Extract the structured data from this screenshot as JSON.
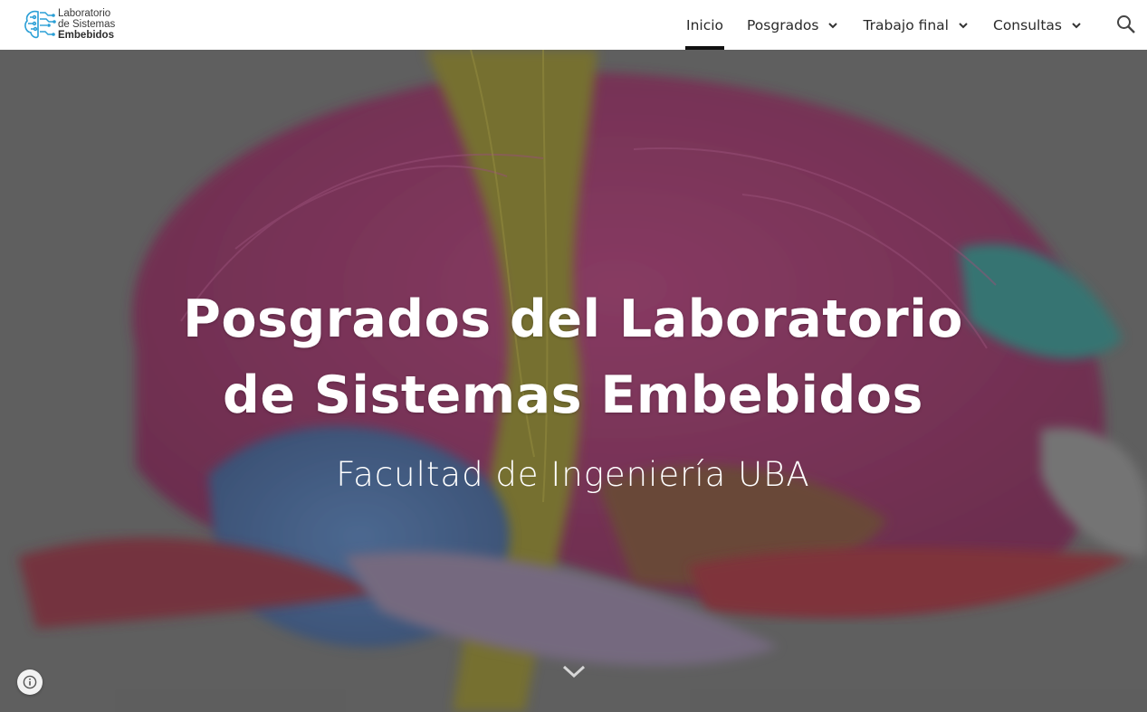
{
  "site": {
    "logo_line1": "Laboratorio",
    "logo_line2": "de Sistemas",
    "logo_line3": "Embebidos"
  },
  "nav": {
    "items": [
      {
        "label": "Inicio",
        "active": true,
        "has_dropdown": false
      },
      {
        "label": "Posgrados",
        "active": false,
        "has_dropdown": true
      },
      {
        "label": "Trabajo final",
        "active": false,
        "has_dropdown": true
      },
      {
        "label": "Consultas",
        "active": false,
        "has_dropdown": true
      }
    ],
    "search_icon": "search-icon"
  },
  "hero": {
    "title_line1": "Posgrados del Laboratorio",
    "title_line2": "de Sistemas Embebidos",
    "subtitle": "Facultad de Ingeniería UBA",
    "background": "brain tractography fibers"
  },
  "footer": {
    "info_icon": "info-icon"
  },
  "colors": {
    "header_bg": "#ffffff",
    "nav_text": "#2a2a2a",
    "active_indicator": "#111111",
    "hero_text": "#ffffff",
    "logo_accent": "#2a9fd6"
  }
}
